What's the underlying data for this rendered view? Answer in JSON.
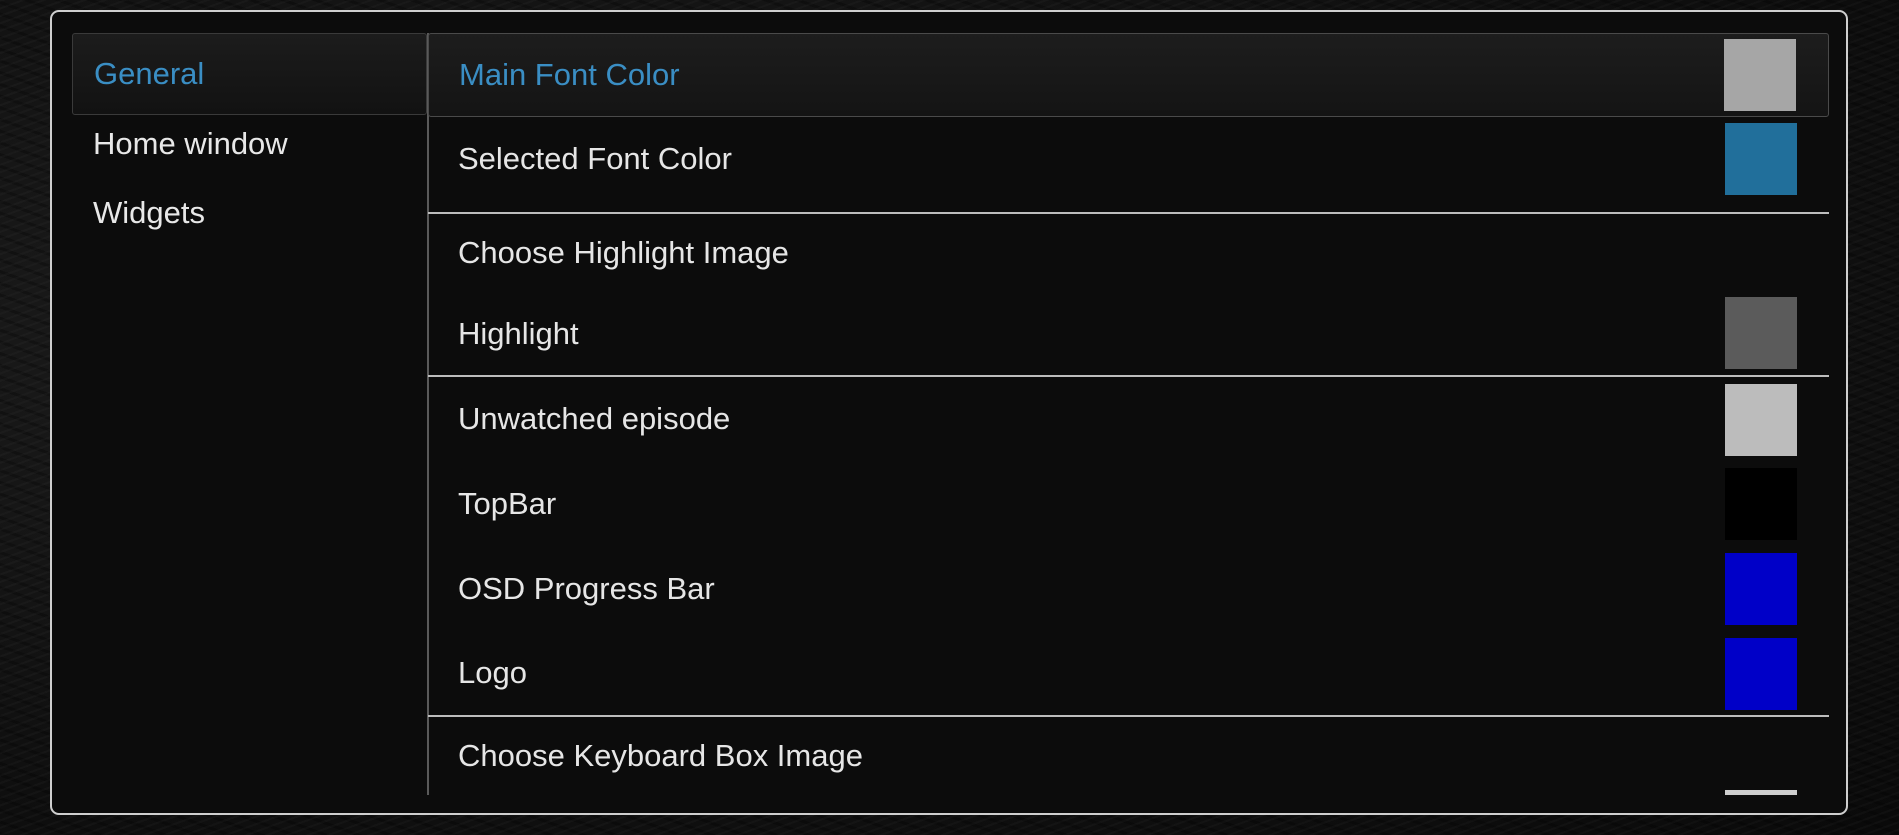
{
  "sidebar": {
    "items": [
      {
        "label": "General",
        "active": true
      },
      {
        "label": "Home window",
        "active": false
      },
      {
        "label": "Widgets",
        "active": false
      }
    ]
  },
  "settings": {
    "rows": [
      {
        "label": "Main Font Color",
        "swatch": "#a6a6a6",
        "focused": true
      },
      {
        "label": "Selected Font Color",
        "swatch": "#216f9b"
      },
      {
        "label": "Choose Highlight Image",
        "swatch": null
      },
      {
        "label": "Highlight",
        "swatch": "#5b5b5b"
      },
      {
        "label": "Unwatched episode",
        "swatch": "#bcbcbc"
      },
      {
        "label": "TopBar",
        "swatch": "#000000"
      },
      {
        "label": "OSD Progress Bar",
        "swatch": "#0000c8"
      },
      {
        "label": "Logo",
        "swatch": "#0000c8"
      },
      {
        "label": "Choose Keyboard Box Image",
        "swatch": null
      }
    ]
  },
  "colors": {
    "accent": "#3a8ec4",
    "text": "#e6e6e6",
    "border": "#cfcfcf"
  }
}
